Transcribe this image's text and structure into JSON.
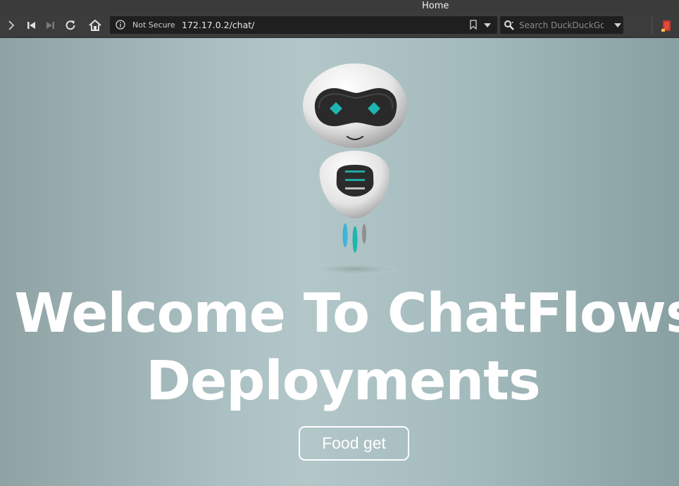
{
  "window": {
    "title": "Home"
  },
  "toolbar": {
    "security_label": "Not Secure",
    "url": "172.17.0.2/chat/",
    "search_placeholder": "Search DuckDuckGo"
  },
  "page": {
    "headline_line1": "Welcome To ChatFlows",
    "headline_line2": "Deployments",
    "cta_label": "Food get"
  },
  "colors": {
    "button_border": "#ffffff",
    "headline": "#ffffff",
    "robot_eyes": "#1fb5b0",
    "robot_jet_blue": "#3fb3d8"
  }
}
